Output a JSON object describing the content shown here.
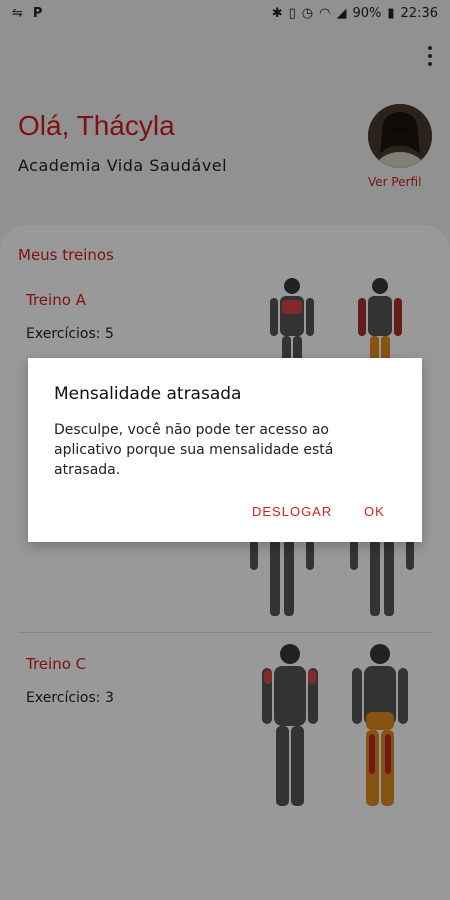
{
  "status_bar": {
    "battery": "90%",
    "time": "22:36"
  },
  "header": {
    "greeting": "Olá, Thácyla",
    "gym_name": "Academia Vida Saudável",
    "profile_link": "Ver Perfil"
  },
  "workouts": {
    "section_title": "Meus treinos",
    "items": [
      {
        "title": "Treino A",
        "exercises": "Exercícios: 5"
      },
      {
        "title": "Treino C",
        "exercises": "Exercícios: 3"
      }
    ]
  },
  "dialog": {
    "title": "Mensalidade atrasada",
    "message": "Desculpe, você não pode ter acesso ao aplicativo porque sua mensalidade está atrasada.",
    "logout_button": "DESLOGAR",
    "ok_button": "OK"
  },
  "colors": {
    "accent": "#d01f1f",
    "highlight_orange": "#e08a1e"
  }
}
